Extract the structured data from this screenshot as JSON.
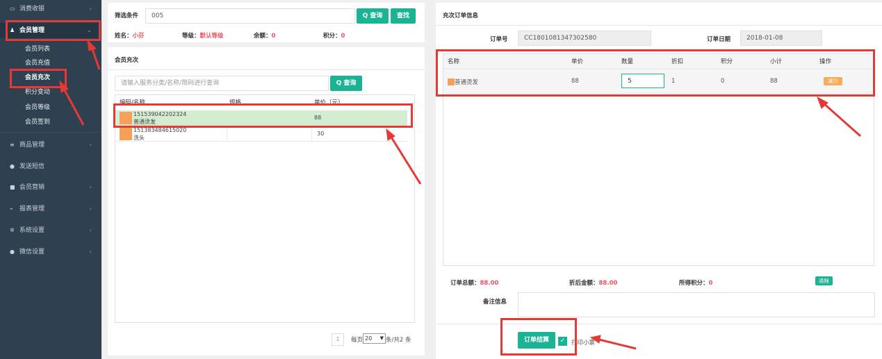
{
  "sidebar": {
    "items": [
      {
        "icon": "card-icon",
        "glyph": "▭",
        "label": "消费收银"
      },
      {
        "icon": "user-icon",
        "glyph": "♟",
        "label": "会员管理"
      },
      {
        "icon": "list-icon",
        "glyph": "≡",
        "label": "商品管理"
      },
      {
        "icon": "chat-icon",
        "glyph": "●",
        "label": "发送短信"
      },
      {
        "icon": "briefcase-icon",
        "glyph": "■",
        "label": "会员营销"
      },
      {
        "icon": "chart-icon",
        "glyph": "⌁",
        "label": "报表管理"
      },
      {
        "icon": "gears-icon",
        "glyph": "✲",
        "label": "系统设置"
      },
      {
        "icon": "wechat-icon",
        "glyph": "●",
        "label": "微信设置"
      }
    ],
    "submenu": [
      "会员列表",
      "会员充值",
      "会员充次",
      "积分变动",
      "会员等级",
      "会员签到"
    ]
  },
  "filter": {
    "label": "筛选条件",
    "value": "005",
    "query_btn": "Q 查询",
    "find_btn": "查找",
    "name_label": "姓名：",
    "name_value": "小芬",
    "level_label": "等级：",
    "level_value": "默认等级",
    "balance_label": "余额：",
    "balance_value": "0",
    "points_label": "积分：",
    "points_value": "0"
  },
  "recharge": {
    "title": "会员充次",
    "search_placeholder": "请输入服务分类/名称/简码进行查询",
    "query_btn": "Q 查询",
    "columns": [
      "编码/名称",
      "规格",
      "单价（元）"
    ],
    "rows": [
      {
        "code": "151539042202324",
        "name": "普通烫发",
        "spec": "",
        "price": "88"
      },
      {
        "code": "151383484615020",
        "name": "洗头",
        "spec": "",
        "price": "30"
      }
    ],
    "pagination": {
      "page": "1",
      "per_page_label": "每页",
      "per_page": "20",
      "total": "条/共2 条"
    }
  },
  "order": {
    "title": "充次订单信息",
    "order_no_label": "订单号",
    "order_no": "CC1801081347302580",
    "order_date_label": "订单日期",
    "order_date": "2018-01-08",
    "columns": [
      "名称",
      "单价",
      "数量",
      "折扣",
      "积分",
      "小计",
      "操作"
    ],
    "items": [
      {
        "name": "普通烫发",
        "price": "88",
        "qty": "5",
        "discount": "1",
        "points": "0",
        "subtotal": "88",
        "action": "减少"
      }
    ],
    "total_label": "订单总额：",
    "total": "88.00",
    "discounted_label": "折后金额：",
    "discounted": "88.00",
    "earned_points_label": "所得积分：",
    "earned_points": "0",
    "clear_btn": "清除",
    "remark_label": "备注信息",
    "checkout_btn": "订单结算",
    "print_label": "打印小票"
  },
  "colors": {
    "accent": "#1ab394",
    "highlight": "#e53935",
    "sidebar": "#2f4050",
    "warn": "#f8ac59"
  }
}
